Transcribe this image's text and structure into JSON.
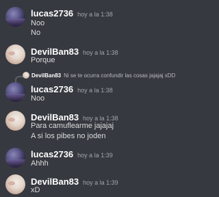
{
  "messages": [
    {
      "author": "lucas2736",
      "timestamp": "hoy a la 1:38",
      "lines": [
        "Noo",
        "No"
      ],
      "avatar": "lucas-avatar"
    },
    {
      "author": "DevilBan83",
      "timestamp": "hoy a la 1:38",
      "lines": [
        "Porque"
      ],
      "avatar": "devil-avatar"
    },
    {
      "reply": {
        "author": "DevilBan83",
        "text": "Ni se te ocurra confundir las cosas jajajaj xDD"
      },
      "author": "lucas2736",
      "timestamp": "hoy a la 1:38",
      "lines": [
        "Noo"
      ],
      "avatar": "lucas-avatar"
    },
    {
      "author": "DevilBan83",
      "timestamp": "hoy a la 1:38",
      "lines": [
        "Para camuflearme jajajaj",
        "A si los pibes no joden"
      ],
      "avatar": "devil-avatar"
    },
    {
      "author": "lucas2736",
      "timestamp": "hoy a la 1:39",
      "lines": [
        "Ahhh"
      ],
      "avatar": "lucas-avatar"
    },
    {
      "author": "DevilBan83",
      "timestamp": "hoy a la 1:39",
      "lines": [
        "xD"
      ],
      "avatar": "devil-avatar"
    }
  ]
}
